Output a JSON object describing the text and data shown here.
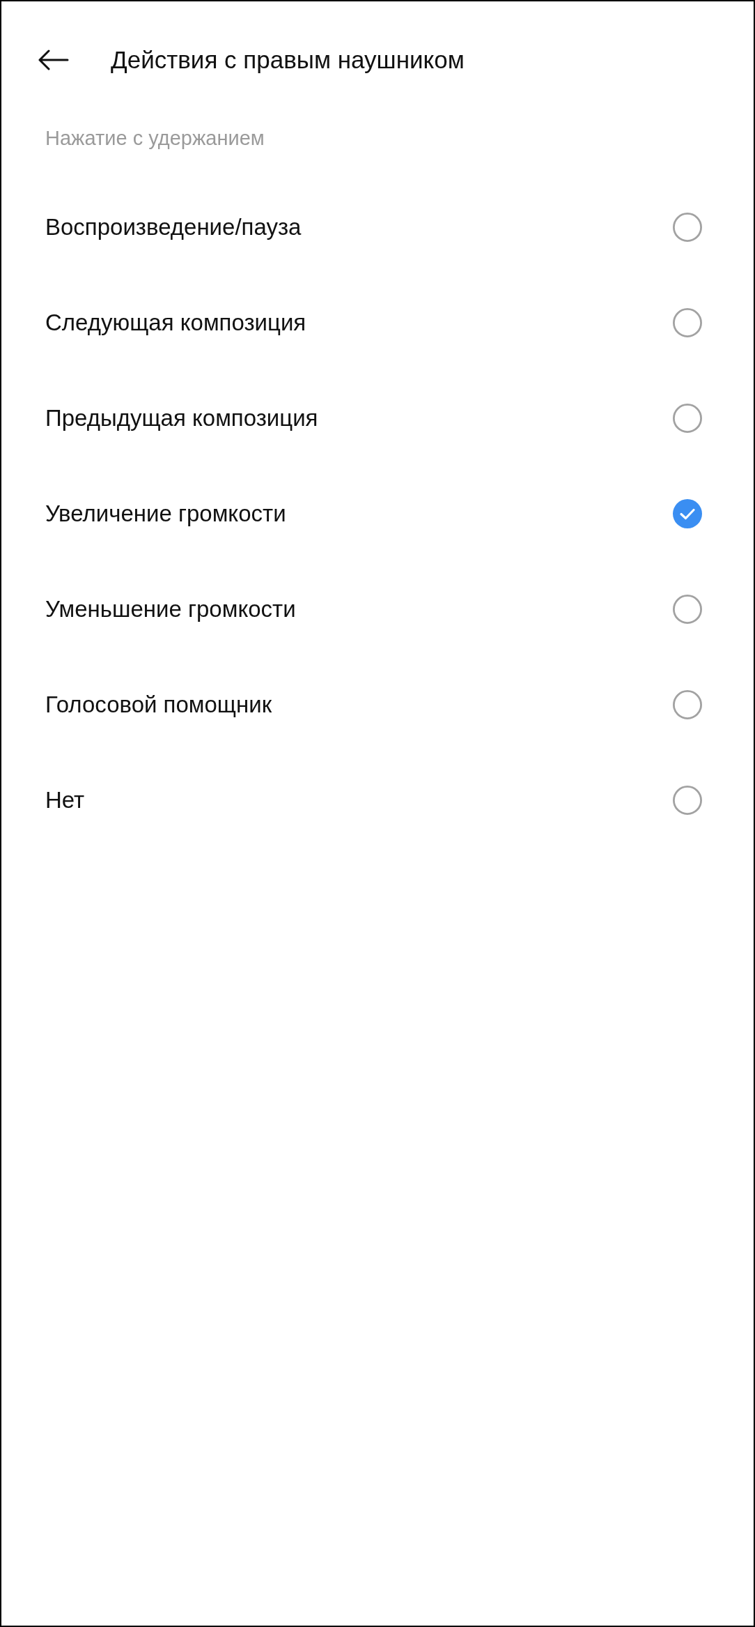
{
  "header": {
    "title": "Действия с правым наушником"
  },
  "section": {
    "label": "Нажатие с удержанием"
  },
  "options": [
    {
      "label": "Воспроизведение/пауза",
      "selected": false
    },
    {
      "label": "Следующая композиция",
      "selected": false
    },
    {
      "label": "Предыдущая композиция",
      "selected": false
    },
    {
      "label": "Увеличение громкости",
      "selected": true
    },
    {
      "label": "Уменьшение громкости",
      "selected": false
    },
    {
      "label": "Голосовой помощник",
      "selected": false
    },
    {
      "label": "Нет",
      "selected": false
    }
  ]
}
